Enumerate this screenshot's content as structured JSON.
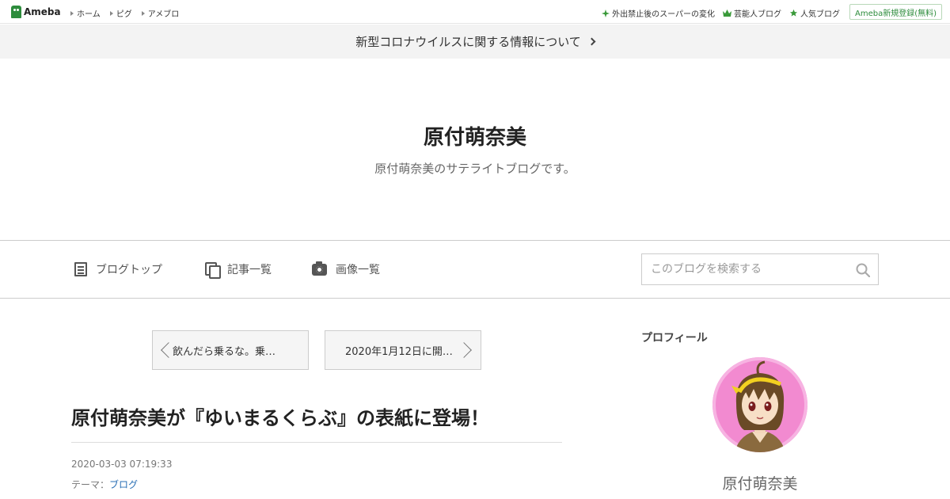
{
  "header": {
    "logo_text": "Ameba",
    "nav_left": [
      "ホーム",
      "ピグ",
      "アメブロ"
    ],
    "nav_right": [
      {
        "icon": "sparkle-icon",
        "label": "外出禁止後のスーパーの変化"
      },
      {
        "icon": "crown-icon",
        "label": "芸能人ブログ"
      },
      {
        "icon": "star-icon",
        "label": "人気ブログ"
      }
    ],
    "register_label": "Ameba新規登録(無料)",
    "accent_color": "#2d8c3c"
  },
  "banner": {
    "text": "新型コロナウイルスに関する情報について"
  },
  "blog": {
    "title": "原付萌奈美",
    "description": "原付萌奈美のサテライトブログです。"
  },
  "menu": {
    "items": [
      {
        "icon": "document-icon",
        "label": "ブログトップ"
      },
      {
        "icon": "pages-icon",
        "label": "記事一覧"
      },
      {
        "icon": "camera-icon",
        "label": "画像一覧"
      }
    ],
    "search_placeholder": "このブログを検索する"
  },
  "pager": {
    "prev_label": "飲んだら乗るな。乗…",
    "next_label": "2020年1月12日に開…"
  },
  "article": {
    "title": "原付萌奈美が『ゆいまるくらぶ』の表紙に登場！",
    "date": "2020-03-03 07:19:33",
    "theme_prefix": "テーマ：",
    "theme_link": "ブログ",
    "link_color": "#2a6fb5"
  },
  "sidebar": {
    "profile_heading": "プロフィール",
    "profile_name": "原付萌奈美"
  }
}
